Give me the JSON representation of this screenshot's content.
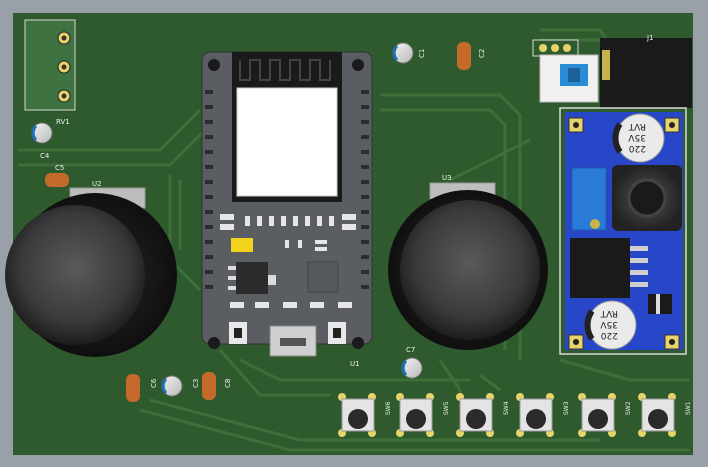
{
  "board": {
    "labels": {
      "rv1": "RV1",
      "c1": "C1",
      "c2": "C2",
      "c3": "C3",
      "c4": "C4",
      "c5": "C5",
      "c6": "C6",
      "c7": "C7",
      "c8": "C8",
      "u1": "U1",
      "u2": "U2",
      "u3": "U3",
      "j1": "J1"
    },
    "switches": [
      "SW6",
      "SW5",
      "SW4",
      "SW3",
      "SW2",
      "SW1"
    ],
    "regulator_caps": {
      "top": {
        "value": "220",
        "voltage": "35V",
        "brand": "RVT"
      },
      "bottom": {
        "value": "220",
        "voltage": "35V",
        "brand": "RVT"
      }
    },
    "colors": {
      "pcb": "#2f5a2e",
      "trace": "#3c6e37",
      "module": "#5a5d62",
      "regulator_board": "#2846c8",
      "pad_gold": "#e8d36b"
    }
  }
}
